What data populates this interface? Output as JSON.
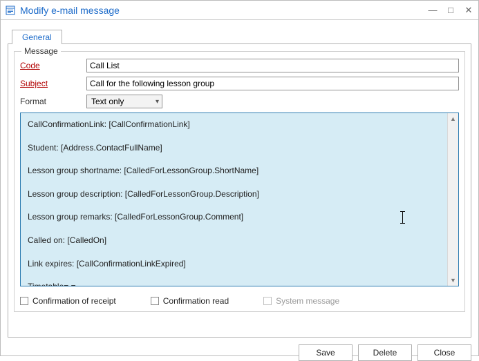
{
  "window": {
    "title": "Modify e-mail message"
  },
  "tabs": {
    "general": "General"
  },
  "fieldset_label": "Message",
  "labels": {
    "code": "Code",
    "subject": "Subject",
    "format": "Format"
  },
  "fields": {
    "code": "Call List",
    "subject": "Call for the following lesson group",
    "format_selected": "Text only"
  },
  "body_text": "CallConfirmationLink: [CallConfirmationLink]\n\nStudent: [Address.ContactFullName]\n\nLesson group shortname: [CalledForLessonGroup.ShortName]\n\nLesson group description: [CalledForLessonGroup.Description]\n\nLesson group remarks: [CalledForLessonGroup.Comment]\n\nCalled on: [CalledOn]\n\nLink expires: [CallConfirmationLinkExpired]\n\nTimetable= =\n [CalledForLessonGroup.LessonGroupTimeTable]|",
  "checkboxes": {
    "receipt": "Confirmation of receipt",
    "read": "Confirmation read",
    "system": "System message"
  },
  "buttons": {
    "save": "Save",
    "delete": "Delete",
    "close": "Close"
  }
}
